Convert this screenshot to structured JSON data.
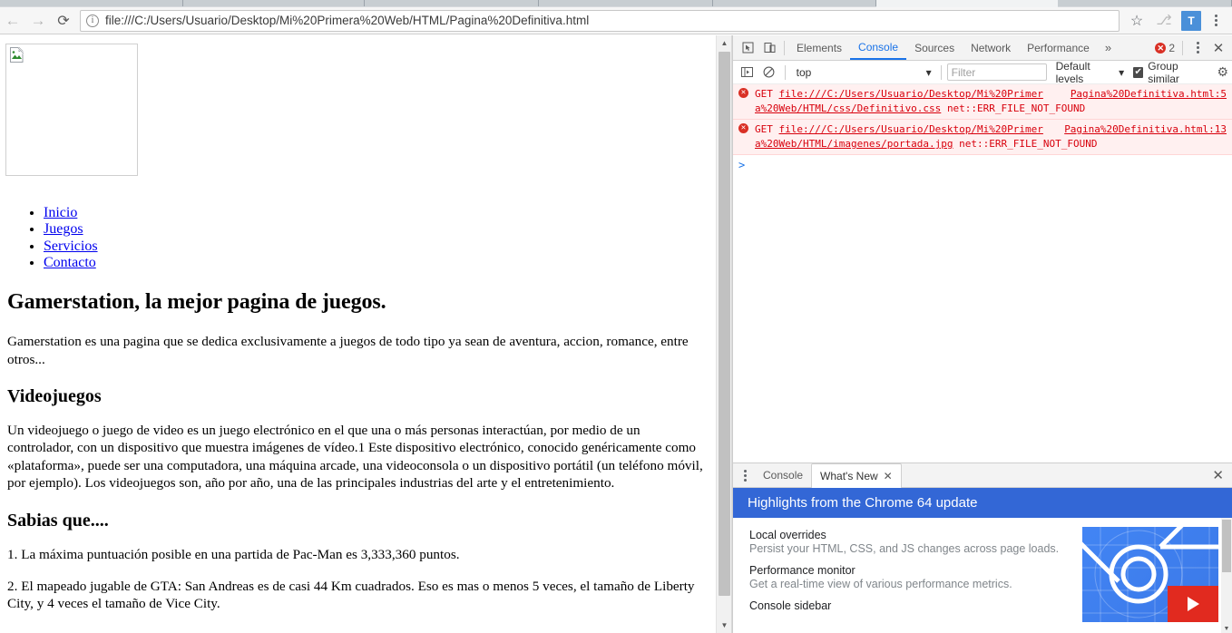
{
  "browser": {
    "back_icon": "←",
    "forward_icon": "→",
    "reload_icon": "⟳",
    "info_icon": "i",
    "url": "file:///C:/Users/Usuario/Desktop/Mi%20Primera%20Web/HTML/Pagina%20Definitiva.html",
    "star_icon": "☆",
    "ext_pdf_label": "⎇",
    "ext_t_label": "T",
    "accent_blue": "#4a90d9"
  },
  "page": {
    "broken_image_alt": "",
    "nav": [
      {
        "label": "Inicio"
      },
      {
        "label": "Juegos"
      },
      {
        "label": "Servicios"
      },
      {
        "label": "Contacto"
      }
    ],
    "h1": "Gamerstation, la mejor pagina de juegos.",
    "intro": "Gamerstation es una pagina que se dedica exclusivamente a juegos de todo tipo ya sean de aventura, accion, romance, entre otros...",
    "h2": "Videojuegos",
    "body": "Un videojuego o juego de video es un juego electrónico en el que una o más personas interactúan, por medio de un controlador, con un dispositivo que muestra imágenes de vídeo.1 Este dispositivo electrónico, conocido genéricamente como «plataforma», puede ser una computadora, una máquina arcade, una videoconsola o un dispositivo portátil (un teléfono móvil, por ejemplo). Los videojuegos son, año por año, una de las principales industrias del arte y el entretenimiento.",
    "h3": "Sabias que....",
    "fact1": "1. La máxima puntuación posible en una partida de Pac-Man es 3,333,360 puntos.",
    "fact2": "2. El mapeado jugable de GTA: San Andreas es de casi 44 Km cuadrados. Eso es mas o menos 5 veces, el tamaño de Liberty City, y 4 veces el tamaño de Vice City.",
    "link_color": "#0000ee"
  },
  "devtools": {
    "inspect_icon": "⬚",
    "device_icon": "▭",
    "tabs": [
      {
        "label": "Elements",
        "active": false
      },
      {
        "label": "Console",
        "active": true
      },
      {
        "label": "Sources",
        "active": false
      },
      {
        "label": "Network",
        "active": false
      },
      {
        "label": "Performance",
        "active": false
      }
    ],
    "more_tabs_icon": "»",
    "error_count": "2",
    "error_badge_icon": "✕",
    "close_icon": "✕",
    "console_toolbar": {
      "sidebar_toggle_icon": "▶",
      "clear_icon": "⊘",
      "context": "top",
      "context_caret": "▾",
      "filter_placeholder": "Filter",
      "filter_value": "",
      "levels_label": "Default levels",
      "levels_caret": "▾",
      "group_similar_label": "Group similar",
      "group_similar_checked": "✔",
      "settings_icon": "⚙"
    },
    "messages": [
      {
        "icon": "✕",
        "method": "GET",
        "url_line1": "file:///C:/Users/Usuario/Desktop/Mi%20Primer",
        "url_line2": "a%20Web/HTML/css/Definitivo.css",
        "error": "net::ERR_FILE_NOT_FOUND",
        "source": "Pagina%20Definitiva.html:5"
      },
      {
        "icon": "✕",
        "method": "GET",
        "url_line1": "file:///C:/Users/Usuario/Desktop/Mi%20Primer",
        "url_line2": "a%20Web/HTML/imagenes/portada.jpg",
        "error": "net::ERR_FILE_NOT_FOUND",
        "source": "Pagina%20Definitiva.html:13"
      }
    ],
    "prompt_symbol": ">",
    "drawer": {
      "tabs": [
        {
          "label": "Console",
          "active": false,
          "closable": false
        },
        {
          "label": "What's New",
          "active": true,
          "closable": true
        }
      ],
      "tab_close_icon": "✕",
      "close_icon": "✕",
      "banner": "Highlights from the Chrome 64 update",
      "banner_color": "#3367d6",
      "items": [
        {
          "title": "Local overrides",
          "desc": "Persist your HTML, CSS, and JS changes across page loads."
        },
        {
          "title": "Performance monitor",
          "desc": "Get a real-time view of various performance metrics."
        },
        {
          "title": "Console sidebar",
          "desc": ""
        }
      ],
      "thumb_play_label": "▶"
    }
  }
}
